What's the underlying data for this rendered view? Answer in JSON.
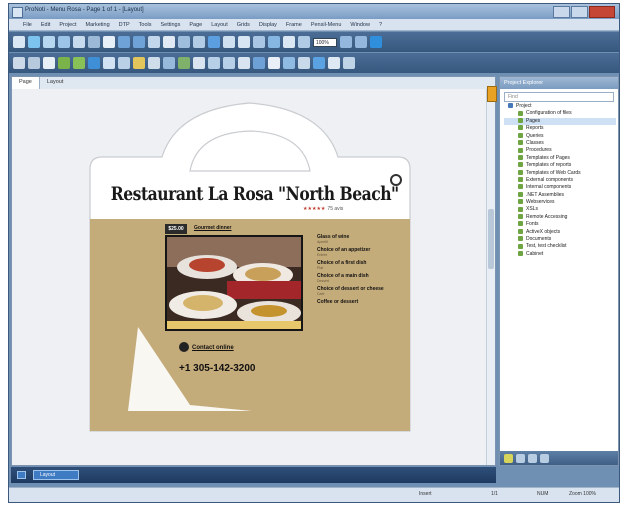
{
  "window": {
    "title": "ProNoti - Menu Rosa - Page 1 of 1 - [Layout]"
  },
  "menubar": [
    "File",
    "Edit",
    "Project",
    "Marketing",
    "DTP",
    "Tools",
    "Settings",
    "Page",
    "Layout",
    "Grids",
    "Display",
    "Frame",
    "Pensil-Menu",
    "Window",
    "?"
  ],
  "toolbar": {
    "zoom_value": "100%"
  },
  "doc_tabs": [
    "Page",
    "Layout"
  ],
  "card": {
    "restaurant_name": "Restaurant La Rosa \"North Beach\"",
    "stars": "★★★★★",
    "reviews": "75 avis",
    "price": "$25.00",
    "deal_title": "Gourmet dinner",
    "menu_items": [
      {
        "item": "Glass of wine",
        "note": "Aperitif"
      },
      {
        "item": "Choice of an appetizer",
        "note": "Entrée"
      },
      {
        "item": "Choice of a first dish",
        "note": "Plat"
      },
      {
        "item": "Choice of a main dish",
        "note": "Dessert"
      },
      {
        "item": "Choice of dessert or cheese",
        "note": "Café"
      },
      {
        "item": "Coffee or dessert",
        "note": ""
      }
    ],
    "contact_label": "Contact online",
    "phone": "+1 305-142-3200"
  },
  "panel": {
    "title": "Project Explorer",
    "search_placeholder": "Find",
    "tree": [
      "Project",
      "Configuration of files",
      "Pages",
      "Reports",
      "Queries",
      "Classes",
      "Procedures",
      "Templates of Pages",
      "Templates of reports",
      "Templates of Web Cards",
      "External components",
      "Internal components",
      ".NET Assemblies",
      "Webservices",
      "XSLs",
      "Remote Accessing",
      "Fonts",
      "ActiveX objects",
      "Documents",
      "Test, test checklist",
      "Cabinet"
    ]
  },
  "bottom_tab": {
    "label": "Layout"
  },
  "status": {
    "field1": "Insert",
    "field2": "1/1",
    "field3": "NUM",
    "field4": "Zoom 100%"
  },
  "colors": {
    "bag_body": "#c4ab7a",
    "toolbar": "#3c5f88",
    "window_frame": "#6f8fb3"
  }
}
